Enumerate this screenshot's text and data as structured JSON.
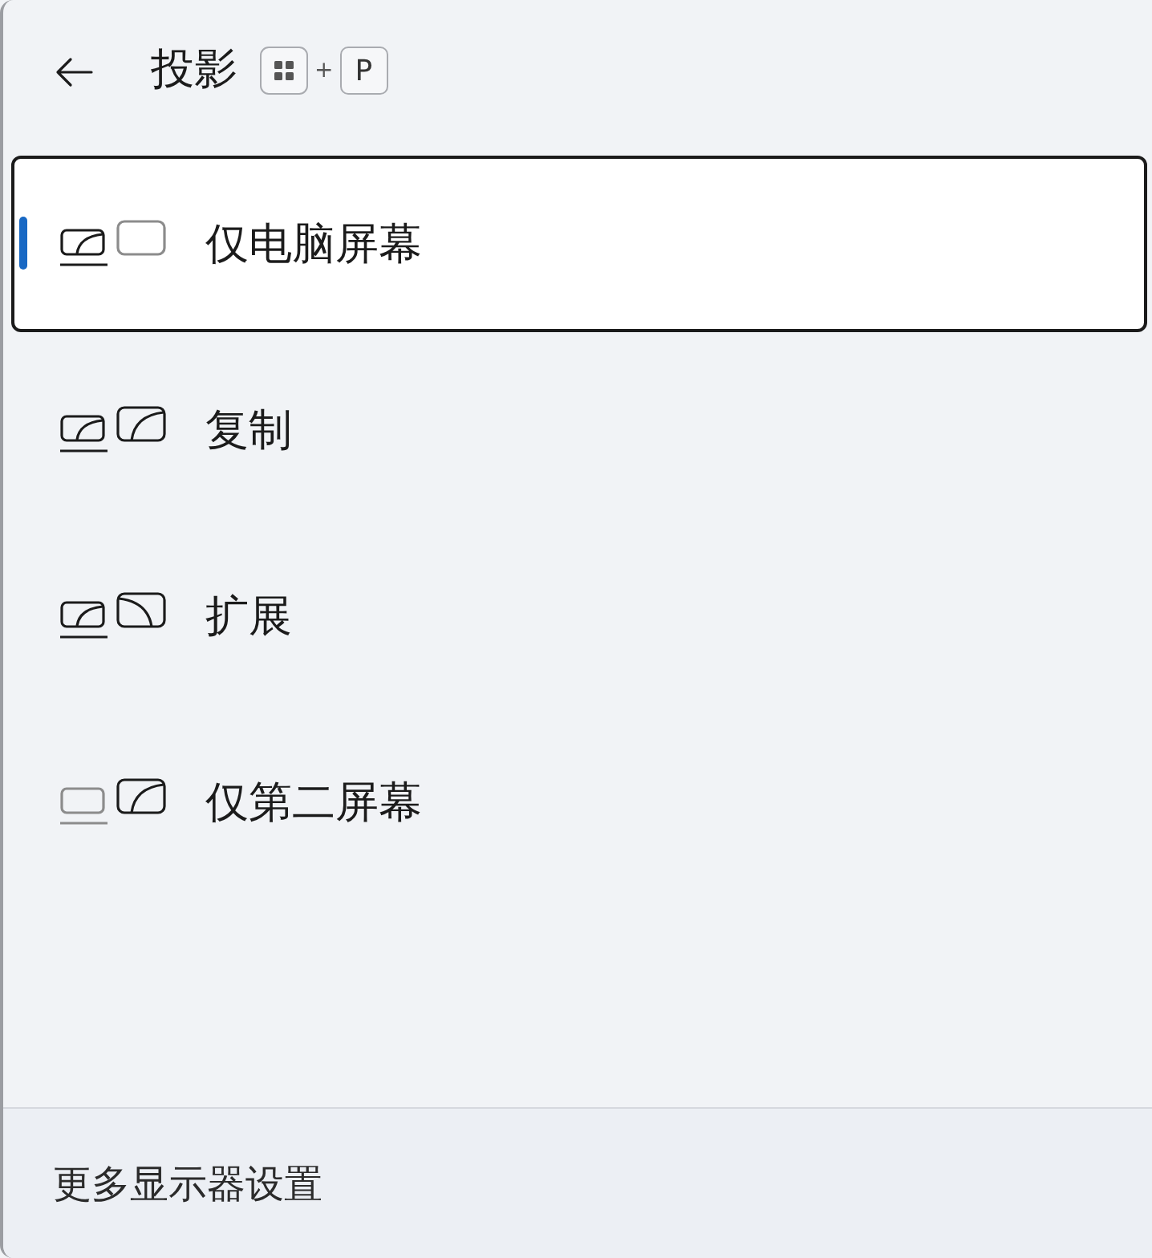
{
  "header": {
    "title": "投影",
    "shortcut": {
      "keys": [
        {
          "kind": "windows-logo"
        },
        {
          "kind": "letter",
          "label": "P"
        }
      ],
      "separator": "+"
    }
  },
  "options": [
    {
      "kind": "pc-only",
      "label": "仅电脑屏幕",
      "selected": true
    },
    {
      "kind": "duplicate",
      "label": "复制",
      "selected": false
    },
    {
      "kind": "extend",
      "label": "扩展",
      "selected": false
    },
    {
      "kind": "second-only",
      "label": "仅第二屏幕",
      "selected": false
    }
  ],
  "footer": {
    "link": "更多显示器设置"
  }
}
